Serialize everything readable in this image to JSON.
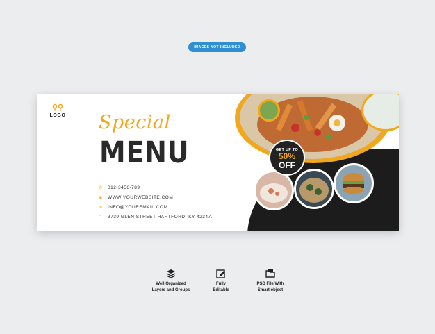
{
  "pill_label": "IMAGES NOT INCLUDED",
  "banner": {
    "logo": "LOGO",
    "logo_mark": "⚲⚲",
    "title_script": "Special",
    "title_main": "MENU",
    "contacts": [
      {
        "icon": "phone-icon",
        "glyph": "✆",
        "text": "012-3456-789"
      },
      {
        "icon": "globe-icon",
        "glyph": "◉",
        "text": "WWW.YOURWEBSITE.COM"
      },
      {
        "icon": "mail-icon",
        "glyph": "✉",
        "text": "INFO@YOUREMAIL.COM"
      },
      {
        "icon": "home-icon",
        "glyph": "⌂",
        "text": "3739 GLEN STREET HARTFORD, KY 42347."
      }
    ],
    "badge": {
      "line1": "GET UP TO",
      "line2": "50%",
      "line3": "OFF"
    }
  },
  "features": [
    {
      "icon": "layers-icon",
      "line1": "Well Organized",
      "line2": "Layers and Groups"
    },
    {
      "icon": "edit-icon",
      "line1": "Fully",
      "line2": "Editable"
    },
    {
      "icon": "folder-icon",
      "line1": "PSD File With",
      "line2": "Smart object"
    }
  ],
  "colors": {
    "accent": "#f2a81d",
    "pill": "#2f8fd1",
    "dark": "#1c1c1c"
  }
}
